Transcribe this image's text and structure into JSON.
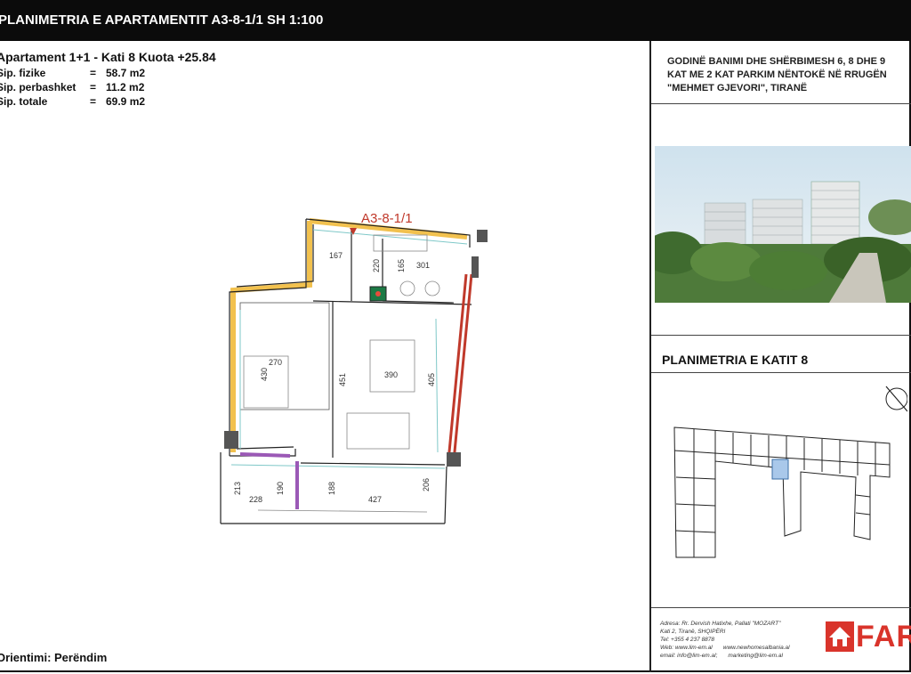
{
  "header": {
    "title": "PLANIMETRIA E APARTAMENTIT A3-8-1/1  SH 1:100"
  },
  "apartment": {
    "line1": "Apartament 1+1 -  Kati 8   Kuota  +25.84",
    "rows": [
      {
        "label": "Sip. fizike",
        "eq": "=",
        "value": "58.7 m2"
      },
      {
        "label": "Sip. perbashket",
        "eq": "=",
        "value": "11.2 m2"
      },
      {
        "label": "Sip. totale",
        "eq": "=",
        "value": "69.9 m2"
      }
    ]
  },
  "orientation": "Orientimi: Perëndim",
  "plan": {
    "unit_label": "A3-8-1/1",
    "dimensions": {
      "d167": "167",
      "d220": "220",
      "d165": "165",
      "d301": "301",
      "d270": "270",
      "d430": "430",
      "d451": "451",
      "d390": "390",
      "d405": "405",
      "d213": "213",
      "d228": "228",
      "d190": "190",
      "d188": "188",
      "d427": "427",
      "d206": "206"
    },
    "colors": {
      "wall": "#f2c14e",
      "accent_red": "#c0392b",
      "door": "#9b59b6",
      "glass": "#7fc8c8"
    }
  },
  "project": {
    "title_lines": [
      "GODINË BANIMI DHE SHËRBIMESH 6, 8 DHE 9",
      "KAT ME 2 KAT PARKIM NËNTOKË NË RRUGËN",
      "\"MEHMET GJEVORI\", TIRANË"
    ]
  },
  "floor_title": "PLANIMETRIA E KATIT 8",
  "contact": {
    "address_line1": "Adresa: Rr. Dervish Hatixhe, Pallati \"MOZART\"",
    "address_line2": "Kati 2, Tiranë, SHQIPËRI",
    "tel": "Tel: +355 4 237 8878",
    "web1": "Web:  www.lim-em.al",
    "web2": "www.newhomesalbania.al",
    "email1": "email: info@lim-em.al;",
    "email2": "marketing@lim-em.al"
  },
  "logo": {
    "text": "FARK",
    "color": "#d9342b"
  }
}
